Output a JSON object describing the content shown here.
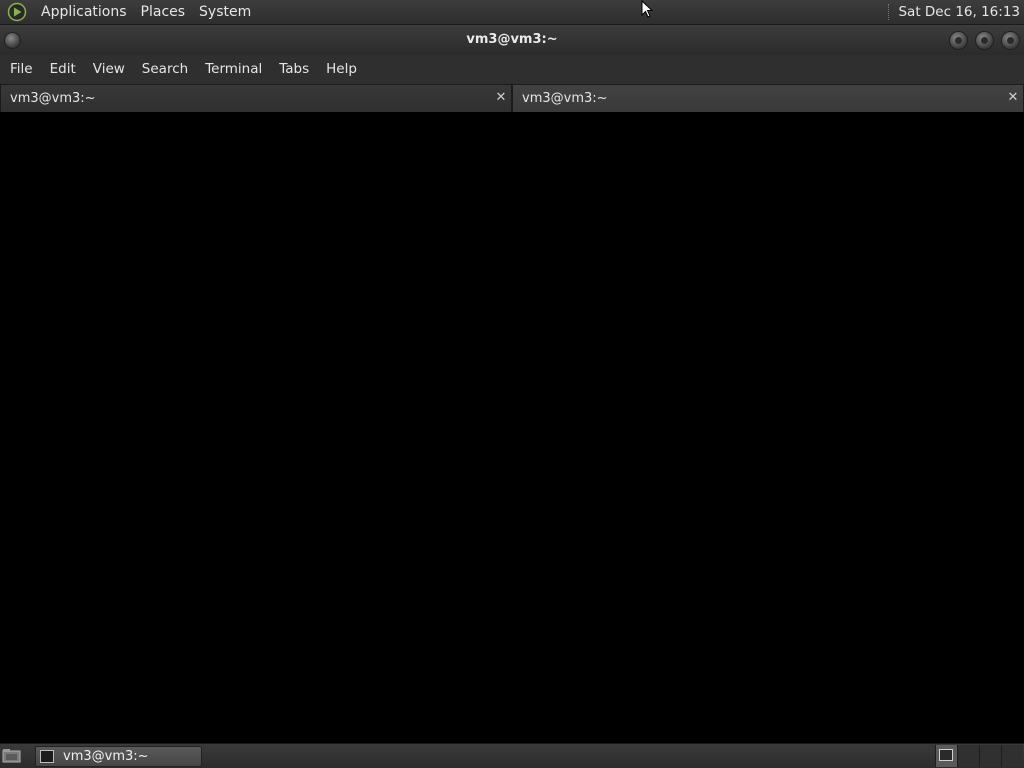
{
  "top_panel": {
    "menus": [
      "Applications",
      "Places",
      "System"
    ],
    "clock": "Sat Dec 16, 16:13"
  },
  "window": {
    "title": "vm3@vm3:~"
  },
  "menubar": {
    "items": [
      "File",
      "Edit",
      "View",
      "Search",
      "Terminal",
      "Tabs",
      "Help"
    ]
  },
  "tabs": [
    {
      "label": "vm3@vm3:~",
      "active": false
    },
    {
      "label": "vm3@vm3:~",
      "active": true
    }
  ],
  "taskbar": {
    "task_label": "vm3@vm3:~",
    "workspaces": 4,
    "current_workspace": 1
  },
  "colors": {
    "terminal_background": "#000000",
    "panel_background": "#333333",
    "text": "#e6e6e6"
  }
}
